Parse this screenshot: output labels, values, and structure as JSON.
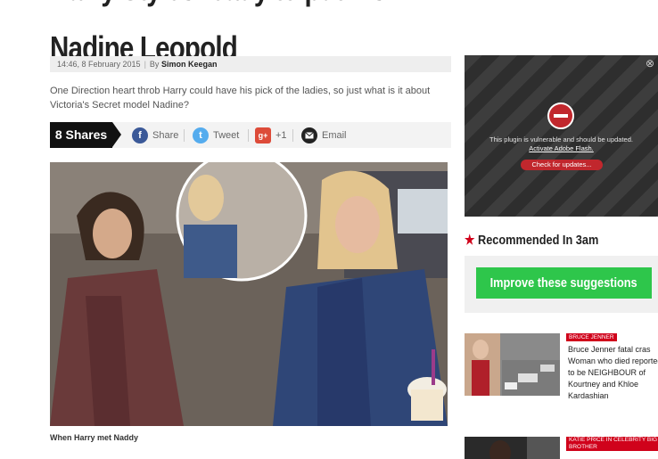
{
  "article": {
    "headline_line1": "Harry Styles ready to put his heart on the line again",
    "headline_line2": "Nadine Leopold",
    "time": "14:46, 8 February 2015",
    "by": "By",
    "author": "Simon Keegan",
    "standfirst": "One Direction heart throb Harry could have his pick of the ladies, so just what is it about Victoria's Secret model Nadine?",
    "caption": "When Harry met Naddy"
  },
  "share": {
    "count": "8 Shares",
    "facebook": "Share",
    "twitter": "Tweet",
    "gplus": "+1",
    "email": "Email"
  },
  "plugin": {
    "message": "This plugin is vulnerable and should be updated.",
    "activate": "Activate Adobe Flash.",
    "check": "Check for updates..."
  },
  "recommended": {
    "title": "Recommended In 3am",
    "improve": "Improve these suggestions",
    "items": [
      {
        "tag": "BRUCE JENNER",
        "text": "Bruce Jenner fatal cras Woman who died reported to be NEIGHBOUR of Kourtney and Khloe Kardashian"
      },
      {
        "tag": "KATIE PRICE IN CELEBRITY BIG BROTHER",
        "text": ""
      }
    ]
  },
  "colors": {
    "accent": "#d0021b",
    "green": "#2ec64b",
    "facebook": "#3b5998",
    "twitter": "#55acee",
    "gplus": "#dd4b39"
  }
}
